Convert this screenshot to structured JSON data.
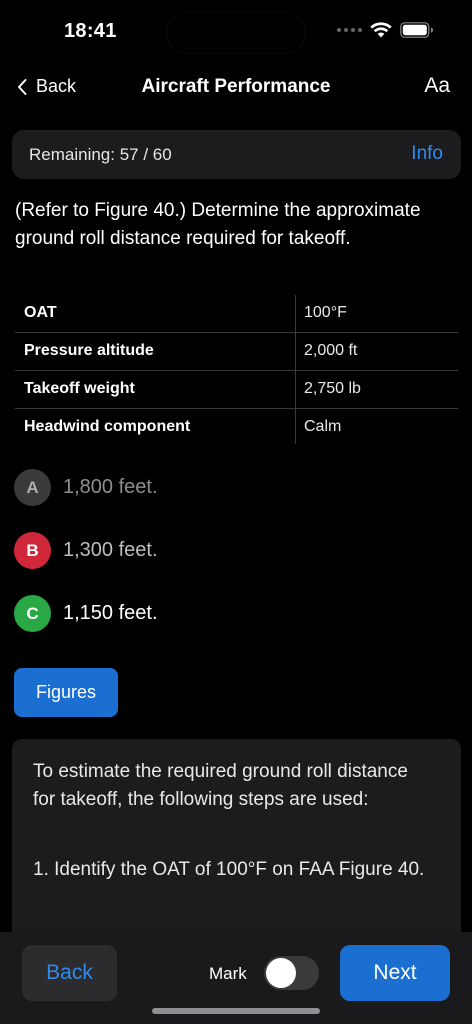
{
  "status_bar": {
    "time": "18:41"
  },
  "nav": {
    "back_label": "Back",
    "title": "Aircraft Performance",
    "font_button": "Aa"
  },
  "progress": {
    "remaining_text": "Remaining: 57 / 60",
    "info_label": "Info"
  },
  "question": {
    "text": "(Refer to Figure 40.) Determine the approximate ground roll distance required for takeoff."
  },
  "conditions": [
    {
      "label": "OAT",
      "value": "100°F"
    },
    {
      "label": "Pressure altitude",
      "value": "2,000 ft"
    },
    {
      "label": "Takeoff weight",
      "value": "2,750 lb"
    },
    {
      "label": "Headwind component",
      "value": "Calm"
    }
  ],
  "answers": [
    {
      "letter": "A",
      "text": "1,800 feet.",
      "badge_color": "#3a3a3c",
      "text_color": "#8e8e93",
      "letter_color": "#aeaeb2"
    },
    {
      "letter": "B",
      "text": "1,300 feet.",
      "badge_color": "#d0283a",
      "text_color": "#bdbdbd",
      "letter_color": "#ffffff"
    },
    {
      "letter": "C",
      "text": "1,150 feet.",
      "badge_color": "#2aa845",
      "text_color": "#ffffff",
      "letter_color": "#ffffff"
    }
  ],
  "figures_button": "Figures",
  "explanation": {
    "paragraph1": "To estimate the required ground roll distance for takeoff, the following steps are used:",
    "paragraph2": "1. Identify the OAT of 100°F on FAA Figure 40."
  },
  "bottom": {
    "back_label": "Back",
    "mark_label": "Mark",
    "mark_on": false,
    "next_label": "Next"
  },
  "colors": {
    "accent": "#2e8bf0",
    "button_blue": "#1a6fd0",
    "background": "#000000",
    "card": "#1c1c1e"
  }
}
